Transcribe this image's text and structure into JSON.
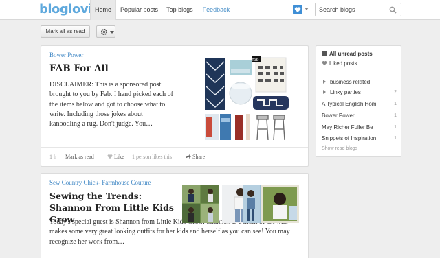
{
  "topbar": {
    "logo": "bloglovin'",
    "nav": [
      "Home",
      "Popular posts",
      "Top blogs",
      "Feedback"
    ],
    "search_placeholder": "Search blogs"
  },
  "toolbar": {
    "mark_all_read": "Mark all as read",
    "settings_icon": "gear-icon"
  },
  "posts": [
    {
      "source": "Bower Power",
      "title": "FAB For All",
      "excerpt": "DISCLAIMER: This is a sponsored post brought to you by Fab. I hand picked each of the items below and got to choose what to write. Including those jokes about kanoodling a rug. Don't judge. You…",
      "image_caption": "fab",
      "footer": {
        "time": "1 h",
        "mark_as_read": "Mark as read",
        "like": "Like",
        "likes_count": "1 person likes this",
        "share": "Share"
      }
    },
    {
      "source": "Sew Country Chick- Farmhouse Couture",
      "title": "Sewing the Trends: Shannon From Little Kids Grow",
      "excerpt": "Today's special guest is Shannon from Little Kids Grow. Shannon is a mom of six who makes some very great looking outfits for her kids and herself as you can see!  You may recognize her work from…"
    }
  ],
  "sidebar": {
    "all_unread": "All unread posts",
    "liked": "Liked posts",
    "groups": [
      {
        "label": "business related",
        "count": ""
      },
      {
        "label": "Linky parties",
        "count": "2"
      }
    ],
    "blogs": [
      {
        "label": "A Typical English Hom",
        "count": "1"
      },
      {
        "label": "Bower Power",
        "count": "1"
      },
      {
        "label": "May Richer Fuller Be",
        "count": "1"
      },
      {
        "label": "Snippets of Inspiration",
        "count": "1"
      }
    ],
    "show_read": "Show read blogs"
  },
  "colors": {
    "accent_blue": "#3e86c4",
    "logo_blue": "#5fa9dd",
    "background": "#eeeeee"
  }
}
